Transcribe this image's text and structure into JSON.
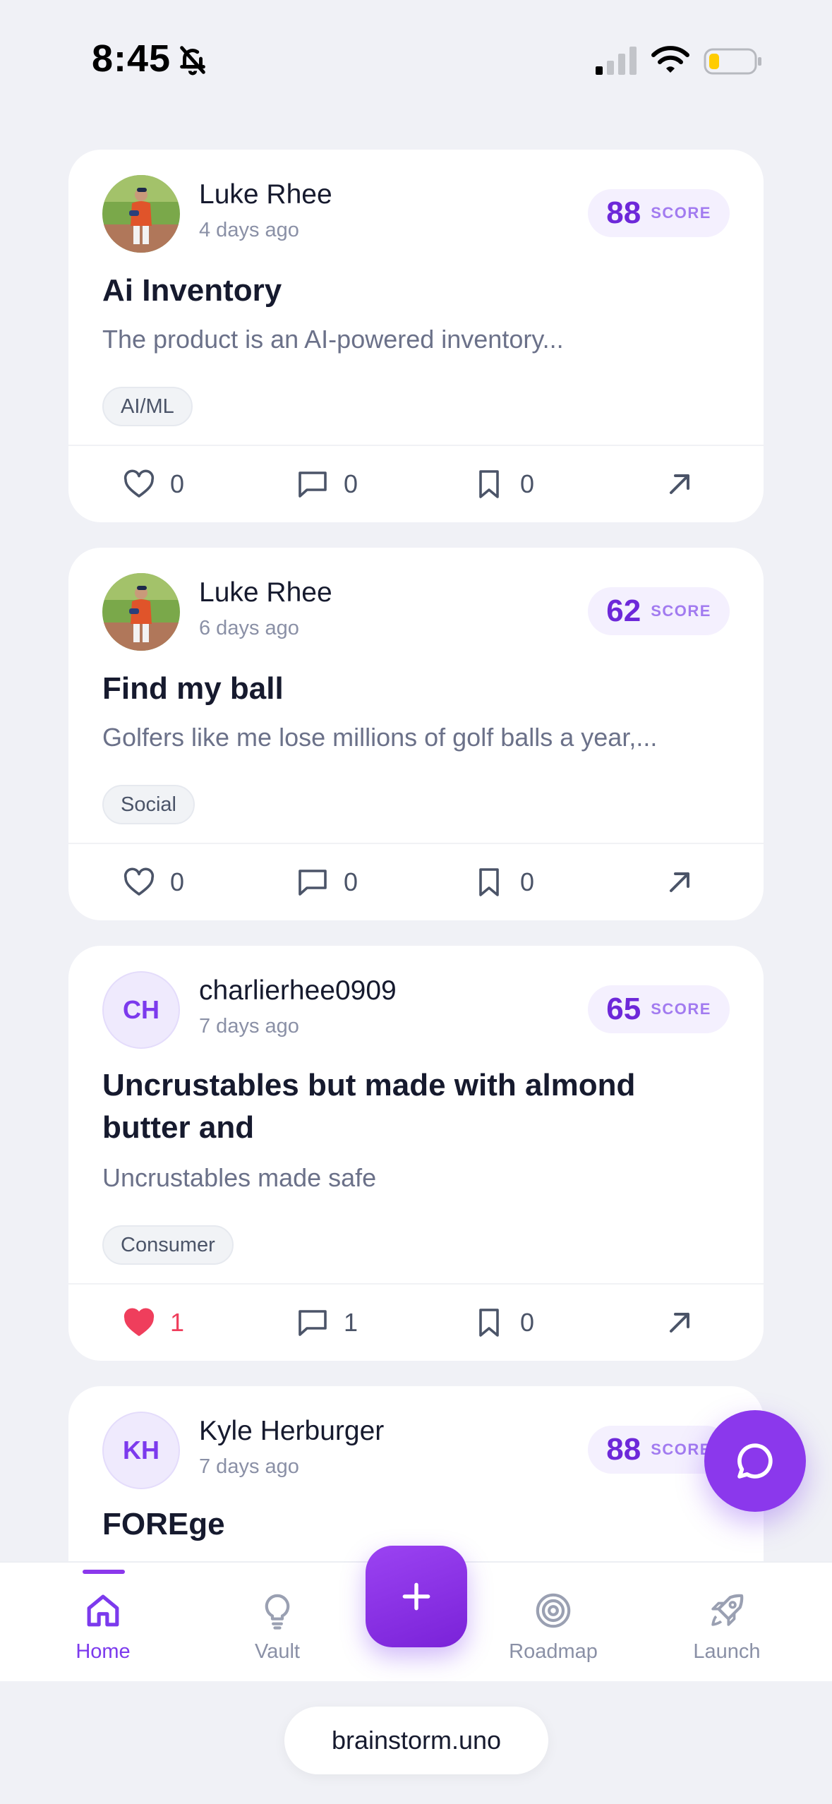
{
  "status_bar": {
    "time": "8:45",
    "icons": [
      "bell-off-icon",
      "cellular-signal-icon",
      "wifi-icon",
      "battery-icon"
    ]
  },
  "feed": {
    "score_label": "SCORE",
    "posts": [
      {
        "author": "Luke Rhee",
        "time": "4 days ago",
        "avatar": "photo",
        "score": "88",
        "title": "Ai Inventory",
        "description": "The product is an AI-powered inventory...",
        "tag": "AI/ML",
        "likes": "0",
        "comments": "0",
        "bookmarks": "0",
        "liked": false
      },
      {
        "author": "Luke Rhee",
        "time": "6 days ago",
        "avatar": "photo",
        "score": "62",
        "title": "Find my ball",
        "description": "Golfers like me lose millions of golf balls a year,...",
        "tag": "Social",
        "likes": "0",
        "comments": "0",
        "bookmarks": "0",
        "liked": false
      },
      {
        "author": "charlierhee0909",
        "time": "7 days ago",
        "avatar_initials": "CH",
        "score": "65",
        "title": "Uncrustables but made with almond butter and",
        "description": "Uncrustables made safe",
        "tag": "Consumer",
        "likes": "1",
        "comments": "1",
        "bookmarks": "0",
        "liked": true
      },
      {
        "author": "Kyle Herburger",
        "time": "7 days ago",
        "avatar_initials": "KH",
        "score": "88",
        "title": "FOREge"
      }
    ]
  },
  "tabbar": {
    "tabs": [
      {
        "label": "Home",
        "icon": "home-icon",
        "active": true
      },
      {
        "label": "Vault",
        "icon": "lightbulb-icon",
        "active": false
      },
      {
        "label": "Roadmap",
        "icon": "target-icon",
        "active": false
      },
      {
        "label": "Launch",
        "icon": "rocket-icon",
        "active": false
      }
    ],
    "add_button_icon": "plus-icon"
  },
  "chat_button_icon": "chat-bubble-icon",
  "browser": {
    "url": "brainstorm.uno"
  },
  "colors": {
    "accent": "#7c3aed",
    "background": "#f0f1f6",
    "like_red": "#ef3e5c"
  }
}
